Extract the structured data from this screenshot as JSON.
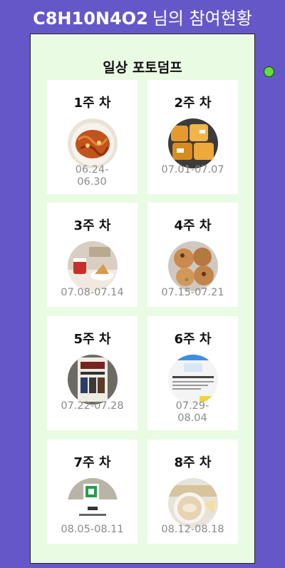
{
  "header": {
    "nickname": "C8H10N4O2",
    "suffix": "님의 참여현황"
  },
  "panel": {
    "title": "일상 포토덤프"
  },
  "weeks": [
    {
      "label": "1주 차",
      "dates": "06.24-06.30",
      "photo": "food-plate-icon"
    },
    {
      "label": "2주 차",
      "dates": "07.01-07.07",
      "photo": "bread-bags-icon"
    },
    {
      "label": "3주 차",
      "dates": "07.08-07.14",
      "photo": "cafe-table-icon"
    },
    {
      "label": "4주 차",
      "dates": "07.15-07.21",
      "photo": "cookies-icon"
    },
    {
      "label": "5주 차",
      "dates": "07.22-07.28",
      "photo": "poster-icon"
    },
    {
      "label": "6주 차",
      "dates": "07.29-08.04",
      "photo": "screenshot-icon"
    },
    {
      "label": "7주 차",
      "dates": "08.05-08.11",
      "photo": "qr-screen-icon"
    },
    {
      "label": "8주 차",
      "dates": "08.12-08.18",
      "photo": "coffee-cup-icon"
    }
  ],
  "colors": {
    "background": "#6657c8",
    "panel": "#eafbe4",
    "status_dot": "#5ee03a",
    "date_text": "#8a8a8a"
  }
}
